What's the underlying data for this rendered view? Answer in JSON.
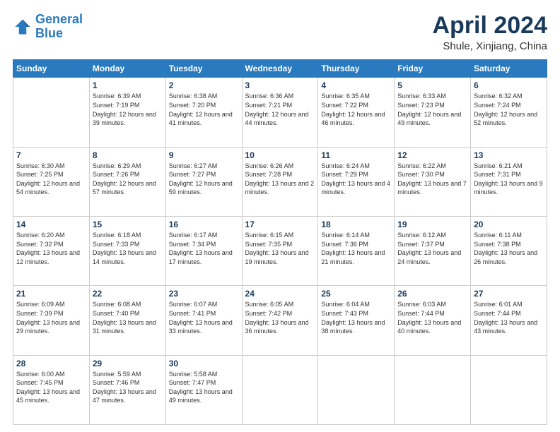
{
  "header": {
    "logo_line1": "General",
    "logo_line2": "Blue",
    "title": "April 2024",
    "location": "Shule, Xinjiang, China"
  },
  "days_of_week": [
    "Sunday",
    "Monday",
    "Tuesday",
    "Wednesday",
    "Thursday",
    "Friday",
    "Saturday"
  ],
  "weeks": [
    [
      {
        "day": "",
        "sunrise": "",
        "sunset": "",
        "daylight": ""
      },
      {
        "day": "1",
        "sunrise": "Sunrise: 6:39 AM",
        "sunset": "Sunset: 7:19 PM",
        "daylight": "Daylight: 12 hours and 39 minutes."
      },
      {
        "day": "2",
        "sunrise": "Sunrise: 6:38 AM",
        "sunset": "Sunset: 7:20 PM",
        "daylight": "Daylight: 12 hours and 41 minutes."
      },
      {
        "day": "3",
        "sunrise": "Sunrise: 6:36 AM",
        "sunset": "Sunset: 7:21 PM",
        "daylight": "Daylight: 12 hours and 44 minutes."
      },
      {
        "day": "4",
        "sunrise": "Sunrise: 6:35 AM",
        "sunset": "Sunset: 7:22 PM",
        "daylight": "Daylight: 12 hours and 46 minutes."
      },
      {
        "day": "5",
        "sunrise": "Sunrise: 6:33 AM",
        "sunset": "Sunset: 7:23 PM",
        "daylight": "Daylight: 12 hours and 49 minutes."
      },
      {
        "day": "6",
        "sunrise": "Sunrise: 6:32 AM",
        "sunset": "Sunset: 7:24 PM",
        "daylight": "Daylight: 12 hours and 52 minutes."
      }
    ],
    [
      {
        "day": "7",
        "sunrise": "Sunrise: 6:30 AM",
        "sunset": "Sunset: 7:25 PM",
        "daylight": "Daylight: 12 hours and 54 minutes."
      },
      {
        "day": "8",
        "sunrise": "Sunrise: 6:29 AM",
        "sunset": "Sunset: 7:26 PM",
        "daylight": "Daylight: 12 hours and 57 minutes."
      },
      {
        "day": "9",
        "sunrise": "Sunrise: 6:27 AM",
        "sunset": "Sunset: 7:27 PM",
        "daylight": "Daylight: 12 hours and 59 minutes."
      },
      {
        "day": "10",
        "sunrise": "Sunrise: 6:26 AM",
        "sunset": "Sunset: 7:28 PM",
        "daylight": "Daylight: 13 hours and 2 minutes."
      },
      {
        "day": "11",
        "sunrise": "Sunrise: 6:24 AM",
        "sunset": "Sunset: 7:29 PM",
        "daylight": "Daylight: 13 hours and 4 minutes."
      },
      {
        "day": "12",
        "sunrise": "Sunrise: 6:22 AM",
        "sunset": "Sunset: 7:30 PM",
        "daylight": "Daylight: 13 hours and 7 minutes."
      },
      {
        "day": "13",
        "sunrise": "Sunrise: 6:21 AM",
        "sunset": "Sunset: 7:31 PM",
        "daylight": "Daylight: 13 hours and 9 minutes."
      }
    ],
    [
      {
        "day": "14",
        "sunrise": "Sunrise: 6:20 AM",
        "sunset": "Sunset: 7:32 PM",
        "daylight": "Daylight: 13 hours and 12 minutes."
      },
      {
        "day": "15",
        "sunrise": "Sunrise: 6:18 AM",
        "sunset": "Sunset: 7:33 PM",
        "daylight": "Daylight: 13 hours and 14 minutes."
      },
      {
        "day": "16",
        "sunrise": "Sunrise: 6:17 AM",
        "sunset": "Sunset: 7:34 PM",
        "daylight": "Daylight: 13 hours and 17 minutes."
      },
      {
        "day": "17",
        "sunrise": "Sunrise: 6:15 AM",
        "sunset": "Sunset: 7:35 PM",
        "daylight": "Daylight: 13 hours and 19 minutes."
      },
      {
        "day": "18",
        "sunrise": "Sunrise: 6:14 AM",
        "sunset": "Sunset: 7:36 PM",
        "daylight": "Daylight: 13 hours and 21 minutes."
      },
      {
        "day": "19",
        "sunrise": "Sunrise: 6:12 AM",
        "sunset": "Sunset: 7:37 PM",
        "daylight": "Daylight: 13 hours and 24 minutes."
      },
      {
        "day": "20",
        "sunrise": "Sunrise: 6:11 AM",
        "sunset": "Sunset: 7:38 PM",
        "daylight": "Daylight: 13 hours and 26 minutes."
      }
    ],
    [
      {
        "day": "21",
        "sunrise": "Sunrise: 6:09 AM",
        "sunset": "Sunset: 7:39 PM",
        "daylight": "Daylight: 13 hours and 29 minutes."
      },
      {
        "day": "22",
        "sunrise": "Sunrise: 6:08 AM",
        "sunset": "Sunset: 7:40 PM",
        "daylight": "Daylight: 13 hours and 31 minutes."
      },
      {
        "day": "23",
        "sunrise": "Sunrise: 6:07 AM",
        "sunset": "Sunset: 7:41 PM",
        "daylight": "Daylight: 13 hours and 33 minutes."
      },
      {
        "day": "24",
        "sunrise": "Sunrise: 6:05 AM",
        "sunset": "Sunset: 7:42 PM",
        "daylight": "Daylight: 13 hours and 36 minutes."
      },
      {
        "day": "25",
        "sunrise": "Sunrise: 6:04 AM",
        "sunset": "Sunset: 7:43 PM",
        "daylight": "Daylight: 13 hours and 38 minutes."
      },
      {
        "day": "26",
        "sunrise": "Sunrise: 6:03 AM",
        "sunset": "Sunset: 7:44 PM",
        "daylight": "Daylight: 13 hours and 40 minutes."
      },
      {
        "day": "27",
        "sunrise": "Sunrise: 6:01 AM",
        "sunset": "Sunset: 7:44 PM",
        "daylight": "Daylight: 13 hours and 43 minutes."
      }
    ],
    [
      {
        "day": "28",
        "sunrise": "Sunrise: 6:00 AM",
        "sunset": "Sunset: 7:45 PM",
        "daylight": "Daylight: 13 hours and 45 minutes."
      },
      {
        "day": "29",
        "sunrise": "Sunrise: 5:59 AM",
        "sunset": "Sunset: 7:46 PM",
        "daylight": "Daylight: 13 hours and 47 minutes."
      },
      {
        "day": "30",
        "sunrise": "Sunrise: 5:58 AM",
        "sunset": "Sunset: 7:47 PM",
        "daylight": "Daylight: 13 hours and 49 minutes."
      },
      {
        "day": "",
        "sunrise": "",
        "sunset": "",
        "daylight": ""
      },
      {
        "day": "",
        "sunrise": "",
        "sunset": "",
        "daylight": ""
      },
      {
        "day": "",
        "sunrise": "",
        "sunset": "",
        "daylight": ""
      },
      {
        "day": "",
        "sunrise": "",
        "sunset": "",
        "daylight": ""
      }
    ]
  ]
}
